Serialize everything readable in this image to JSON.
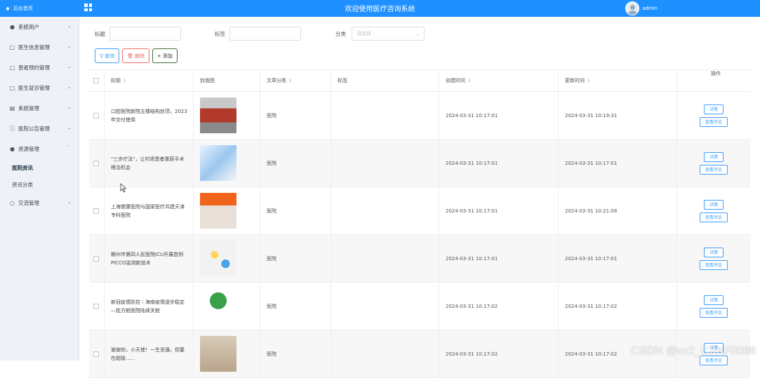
{
  "header": {
    "brand": "后台首页",
    "title": "欢迎使用医疗咨询系统",
    "username": "admin"
  },
  "sidebar": {
    "items": [
      {
        "label": "系统用户",
        "icon": "user-icon"
      },
      {
        "label": "医生信息管理",
        "icon": "doctor-icon"
      },
      {
        "label": "患者预约管理",
        "icon": "appointment-icon"
      },
      {
        "label": "医生就诊管理",
        "icon": "consult-icon"
      },
      {
        "label": "系统管理",
        "icon": "settings-icon"
      },
      {
        "label": "医院公告管理",
        "icon": "notice-icon"
      },
      {
        "label": "资源管理",
        "icon": "location-icon"
      },
      {
        "label": "交流管理",
        "icon": "chat-icon"
      }
    ],
    "resource_sub": [
      "医院资讯",
      "资讯分类"
    ]
  },
  "filters": {
    "title_label": "标题",
    "tags_label": "标签",
    "category_label": "分类",
    "category_placeholder": "请选择"
  },
  "buttons": {
    "query": "查询",
    "delete": "删除",
    "add": "添加"
  },
  "table": {
    "headers": {
      "title": "标题",
      "cover": "封面图",
      "category": "文章分类",
      "tags": "标签",
      "created": "创建时间",
      "updated": "更新时间",
      "ops": "操作"
    },
    "op_detail": "详情",
    "op_comment": "查看评论",
    "rows": [
      {
        "title": "口腔医院新院主楼结构封顶，2023年交付使用",
        "category": "医院",
        "tags": "",
        "created": "2024-03-31 10:17:01",
        "updated": "2024-03-31 10:19:31"
      },
      {
        "title": "\"三步疗法\"，让村退患者重获手术根治机会",
        "category": "医院",
        "tags": "",
        "created": "2024-03-31 10:17:01",
        "updated": "2024-03-31 10:17:01"
      },
      {
        "title": "上海健康医院与国家医疗共建天津专科医院",
        "category": "医院",
        "tags": "",
        "created": "2024-03-31 10:17:01",
        "updated": "2024-03-31 10:21:08"
      },
      {
        "title": "郴州市第四人民医院ICU开展首例PICCO监测新技术",
        "category": "医院",
        "tags": "",
        "created": "2024-03-31 10:17:01",
        "updated": "2024-03-31 10:17:01"
      },
      {
        "title": "新冠疫情防控｜海南疫情逐步稳定—批方舱医院陆续关舱",
        "category": "医院",
        "tags": "",
        "created": "2024-03-31 10:17:02",
        "updated": "2024-03-31 10:17:02"
      },
      {
        "title": "谢谢你，小天使！一生坚强，但要在超级......",
        "category": "医院",
        "tags": "",
        "created": "2024-03-31 10:17:02",
        "updated": "2024-03-31 10:17:02"
      }
    ]
  },
  "watermark": "CSDN @vx2_CXKF0088"
}
